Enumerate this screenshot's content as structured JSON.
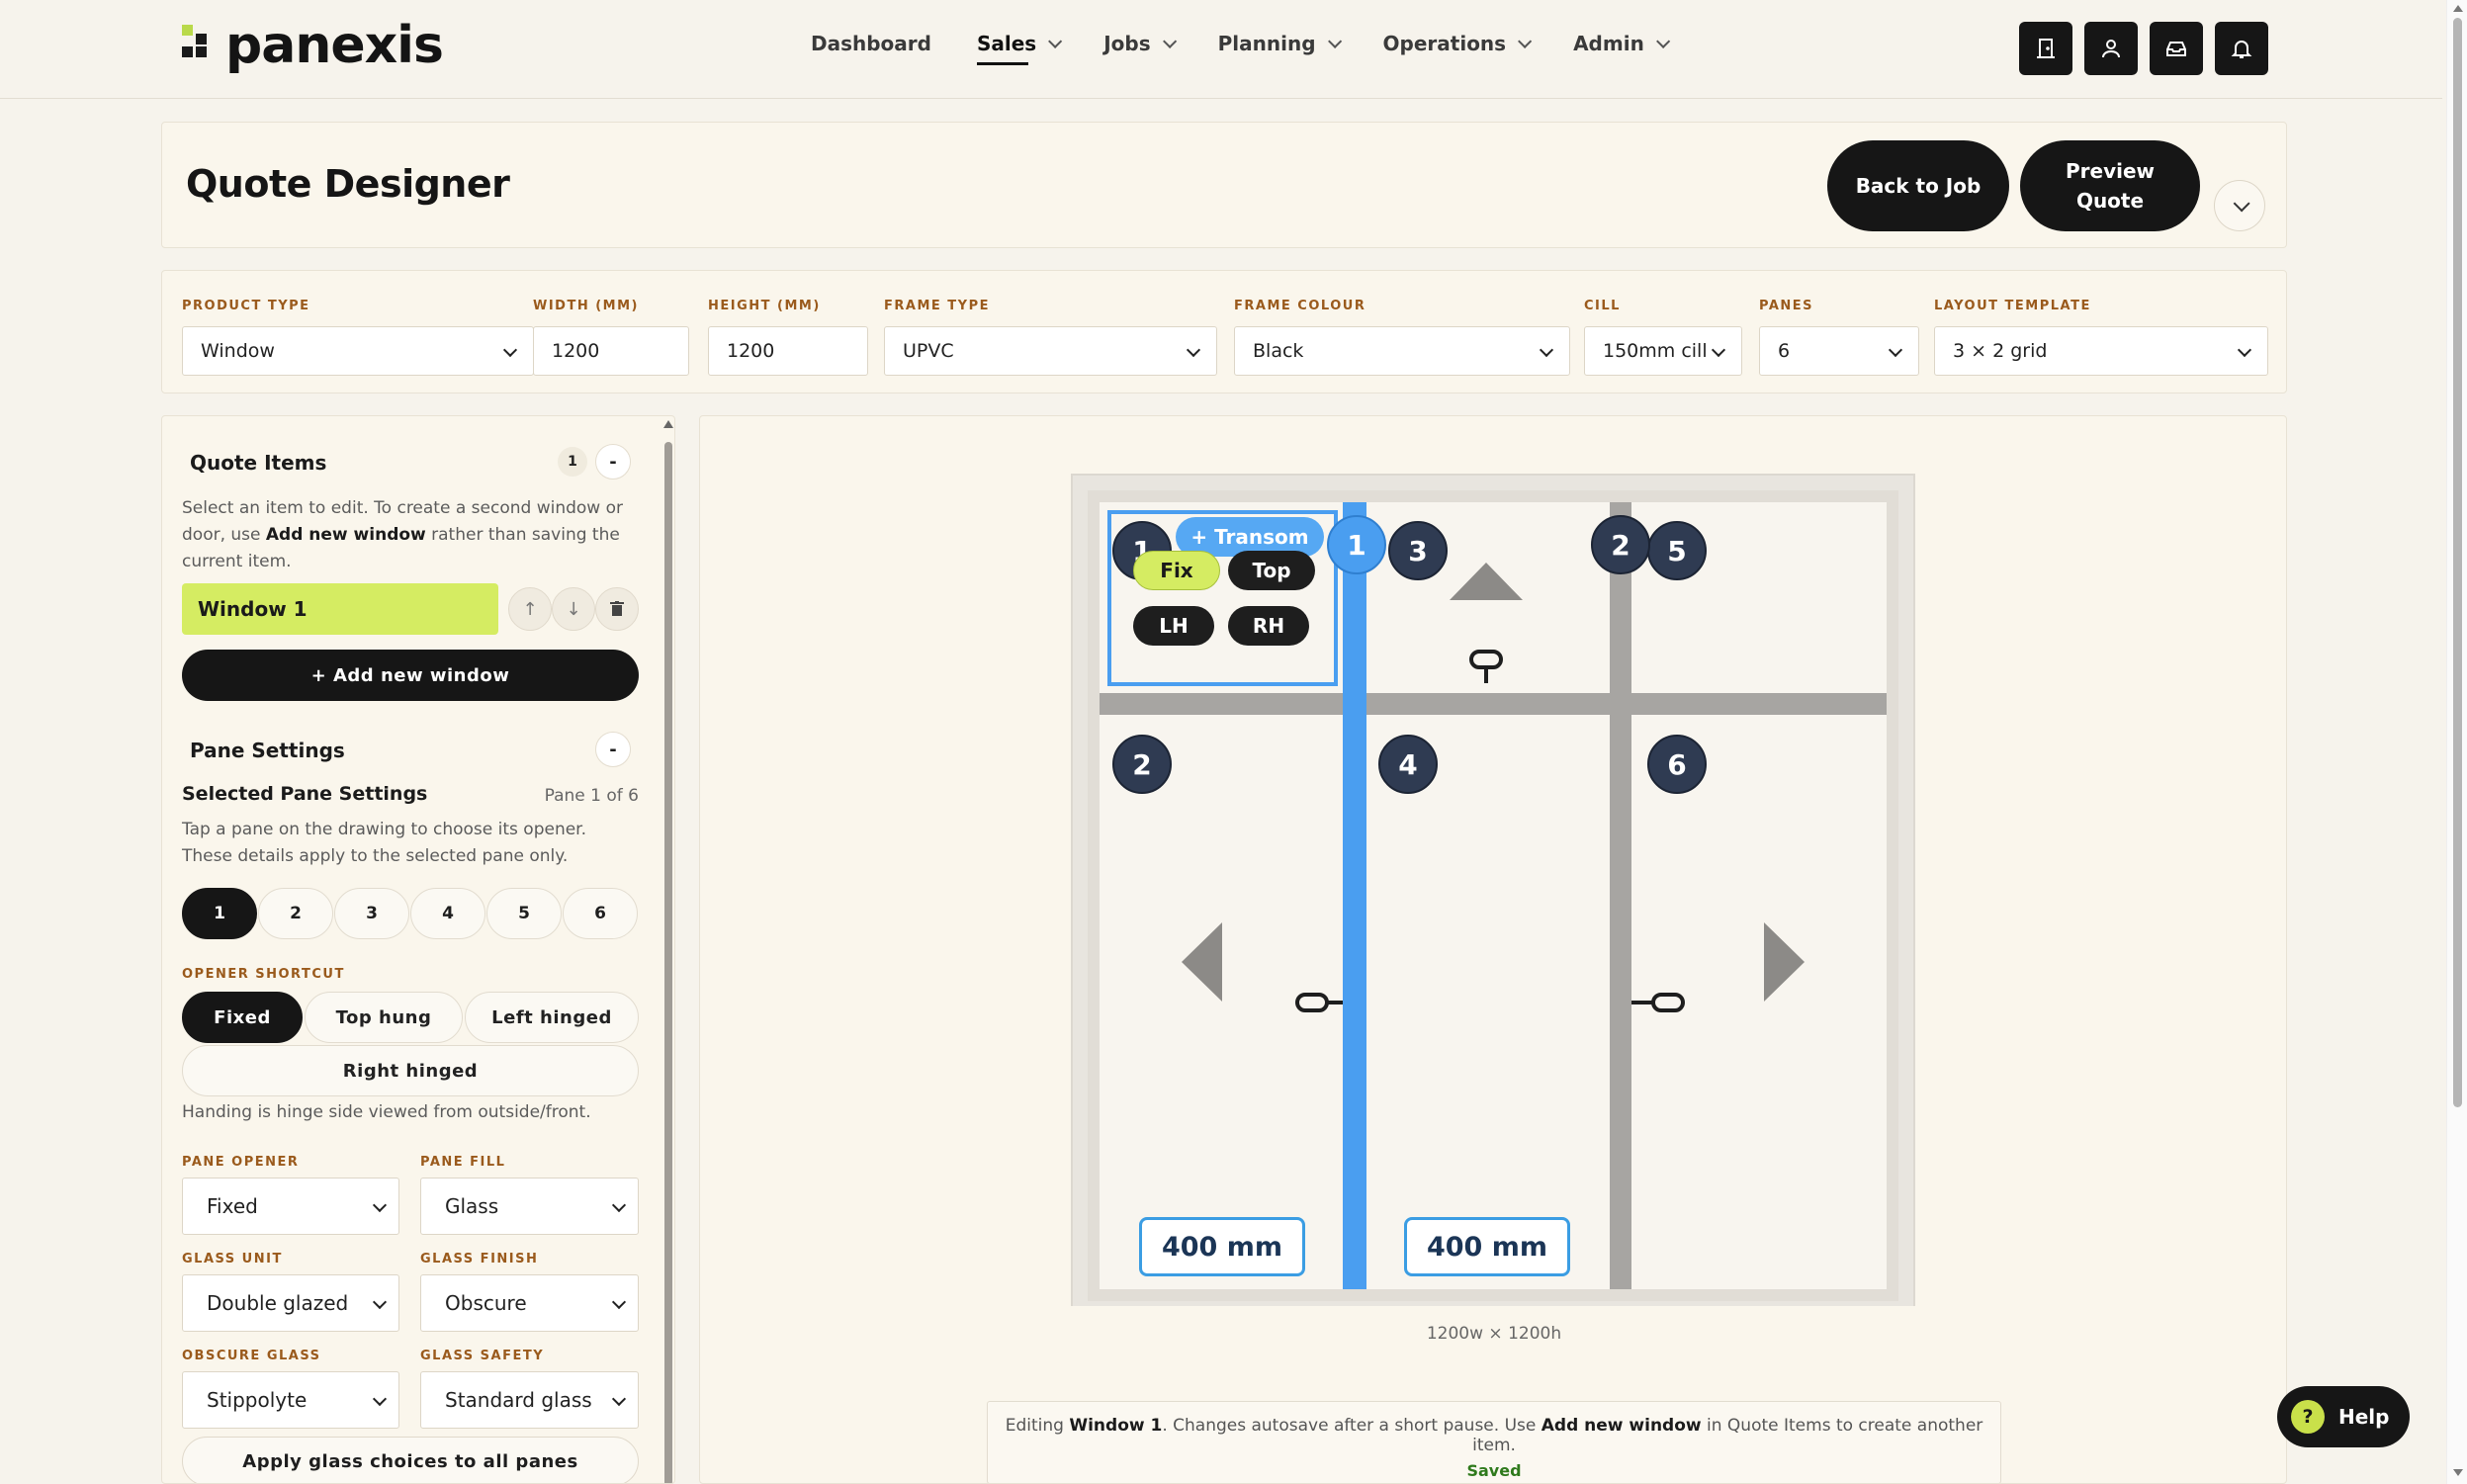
{
  "brand": {
    "name": "panexis"
  },
  "nav": {
    "items": [
      {
        "label": "Dashboard",
        "has_menu": false,
        "active": false
      },
      {
        "label": "Sales",
        "has_menu": true,
        "active": true
      },
      {
        "label": "Jobs",
        "has_menu": true,
        "active": false
      },
      {
        "label": "Planning",
        "has_menu": true,
        "active": false
      },
      {
        "label": "Operations",
        "has_menu": true,
        "active": false
      },
      {
        "label": "Admin",
        "has_menu": true,
        "active": false
      }
    ],
    "icons": [
      "door-icon",
      "user-icon",
      "inbox-icon",
      "bell-icon"
    ]
  },
  "header": {
    "title": "Quote Designer",
    "back_label": "Back to Job",
    "preview_label_line1": "Preview",
    "preview_label_line2": "Quote"
  },
  "config": {
    "product_type": {
      "label": "PRODUCT TYPE",
      "value": "Window"
    },
    "width": {
      "label": "WIDTH (MM)",
      "value": "1200"
    },
    "height": {
      "label": "HEIGHT (MM)",
      "value": "1200"
    },
    "frame_type": {
      "label": "FRAME TYPE",
      "value": "UPVC"
    },
    "frame_colour": {
      "label": "FRAME COLOUR",
      "value": "Black"
    },
    "cill": {
      "label": "CILL",
      "value": "150mm cill"
    },
    "panes": {
      "label": "PANES",
      "value": "6"
    },
    "layout_template": {
      "label": "LAYOUT TEMPLATE",
      "value": "3 × 2 grid"
    }
  },
  "quote_items": {
    "title": "Quote Items",
    "count": "1",
    "collapse": "-",
    "help_prefix": "Select an item to edit. To create a second window or door, use ",
    "help_bold": "Add new window",
    "help_suffix": " rather than saving the current item.",
    "items": [
      {
        "label": "Window 1"
      }
    ],
    "move_up": "↑",
    "move_down": "↓",
    "delete_icon": "trash-icon",
    "add_label": "+ Add new window"
  },
  "pane_settings": {
    "title": "Pane Settings",
    "collapse": "-",
    "sub_title": "Selected Pane Settings",
    "pane_of": "Pane 1 of 6",
    "help": "Tap a pane on the drawing to choose its opener. These details apply to the selected pane only.",
    "panes": [
      "1",
      "2",
      "3",
      "4",
      "5",
      "6"
    ],
    "selected_pane": "1",
    "opener_shortcut_label": "OPENER SHORTCUT",
    "shortcuts": [
      "Fixed",
      "Top hung",
      "Left hinged",
      "Right hinged"
    ],
    "active_shortcut": "Fixed",
    "handing_hint": "Handing is hinge side viewed from outside/front.",
    "pane_opener": {
      "label": "PANE OPENER",
      "value": "Fixed"
    },
    "pane_fill": {
      "label": "PANE FILL",
      "value": "Glass"
    },
    "glass_unit": {
      "label": "GLASS UNIT",
      "value": "Double glazed"
    },
    "glass_finish": {
      "label": "GLASS FINISH",
      "value": "Obscure"
    },
    "obscure_glass": {
      "label": "OBSCURE GLASS",
      "value": "Stippolyte"
    },
    "glass_safety": {
      "label": "GLASS SAFETY",
      "value": "Standard glass"
    },
    "apply_label": "Apply glass choices to all panes"
  },
  "drawing": {
    "frame_colour": "#e9e6e0",
    "mullion_colour": "#a7a5a2",
    "selected_colour": "#4a9ef0",
    "pane_badges": [
      "1",
      "2",
      "3",
      "4",
      "5",
      "6"
    ],
    "mullion_badges": [
      "1",
      "2"
    ],
    "quick_tags": {
      "transom": "+ Transom",
      "fix": "Fix",
      "top": "Top",
      "lh": "LH",
      "rh": "RH"
    },
    "dims": [
      "400 mm",
      "400 mm"
    ],
    "caption": "1200w × 1200h"
  },
  "status": {
    "prefix": "Editing ",
    "item": "Window 1",
    "middle": ". Changes autosave after a short pause. Use ",
    "bold": "Add new window",
    "suffix": " in Quote Items to create another item.",
    "saved": "Saved"
  },
  "help": {
    "label": "Help",
    "icon": "?"
  }
}
